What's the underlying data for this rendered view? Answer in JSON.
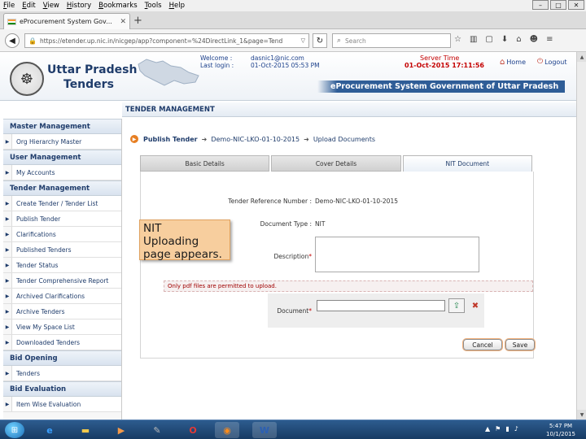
{
  "browser": {
    "menu": [
      "File",
      "Edit",
      "View",
      "History",
      "Bookmarks",
      "Tools",
      "Help"
    ],
    "window_controls": [
      "–",
      "□",
      "✕"
    ],
    "tab_title": "eProcurement System Gov...",
    "url": "https://etender.up.nic.in/nicgep/app?component=%24DirectLink_1&page=Tend",
    "search_placeholder": "Search"
  },
  "header": {
    "brand_line1": "Uttar Pradesh",
    "brand_line2": "Tenders",
    "welcome_label": "Welcome :",
    "welcome_value": "dasnic1@nic.com",
    "last_login_label": "Last login :",
    "last_login_value": "01-Oct-2015 05:53 PM",
    "server_time_label": "Server Time",
    "server_time_value": "01-Oct-2015 17:11:56",
    "home_label": "Home",
    "logout_label": "Logout",
    "system_name": "eProcurement System Government of Uttar Pradesh"
  },
  "sidebar": {
    "sections": [
      {
        "title": "Master Management",
        "items": [
          "Org Hierarchy Master"
        ]
      },
      {
        "title": "User Management",
        "items": [
          "My Accounts"
        ]
      },
      {
        "title": "Tender Management",
        "items": [
          "Create Tender / Tender List",
          "Publish Tender",
          "Clarifications",
          "Published Tenders",
          "Tender Status",
          "Tender Comprehensive Report",
          "Archived Clarifications",
          "Archive Tenders",
          "View My Space List",
          "Downloaded Tenders"
        ]
      },
      {
        "title": "Bid Opening",
        "items": [
          "Tenders"
        ]
      },
      {
        "title": "Bid Evaluation",
        "items": [
          "Item Wise Evaluation"
        ]
      }
    ]
  },
  "main": {
    "section_title": "TENDER MANAGEMENT",
    "breadcrumb": [
      "Publish Tender",
      "Demo-NIC-LKO-01-10-2015",
      "Upload Documents"
    ],
    "tabs": [
      "Basic Details",
      "Cover Details",
      "NIT Document"
    ],
    "form": {
      "tender_ref_label": "Tender Reference Number :",
      "tender_ref_value": "Demo-NIC-LKO-01-10-2015",
      "doc_type_label": "Document Type :",
      "doc_type_value": "NIT",
      "description_label": "Description",
      "note": "Only pdf files are permitted to upload.",
      "document_label": "Document",
      "cancel_label": "Cancel",
      "save_label": "Save"
    }
  },
  "callout": {
    "lines": [
      "NIT",
      "Uploading",
      "page appears."
    ]
  },
  "taskbar": {
    "time": "5:47 PM",
    "date": "10/1/2015"
  }
}
